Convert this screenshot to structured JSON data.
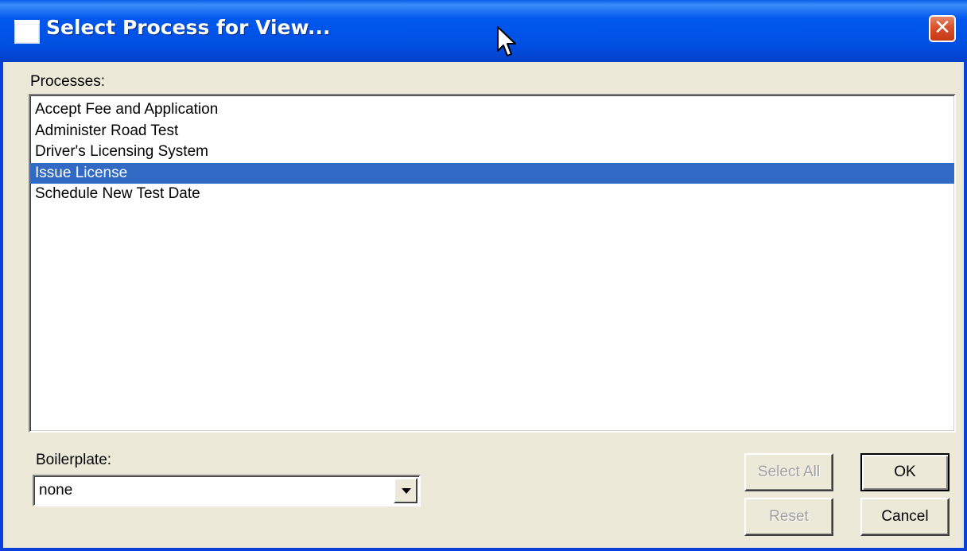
{
  "window": {
    "title": "Select Process for View...",
    "close_glyph": "✕",
    "icon": "window-icon"
  },
  "processes": {
    "label": "Processes:",
    "items": [
      {
        "label": "Accept Fee and Application",
        "selected": false
      },
      {
        "label": "Administer Road Test",
        "selected": false
      },
      {
        "label": "Driver's Licensing System",
        "selected": false
      },
      {
        "label": "Issue License",
        "selected": true
      },
      {
        "label": "Schedule New Test Date",
        "selected": false
      }
    ]
  },
  "boilerplate": {
    "label": "Boilerplate:",
    "value": "none"
  },
  "buttons": {
    "select_all": "Select All",
    "reset": "Reset",
    "ok": "OK",
    "cancel": "Cancel"
  },
  "colors": {
    "titlebar": "#0058ee",
    "selection": "#316ac5",
    "dialog_bg": "#ece9d8",
    "close_button": "#d8502a"
  }
}
